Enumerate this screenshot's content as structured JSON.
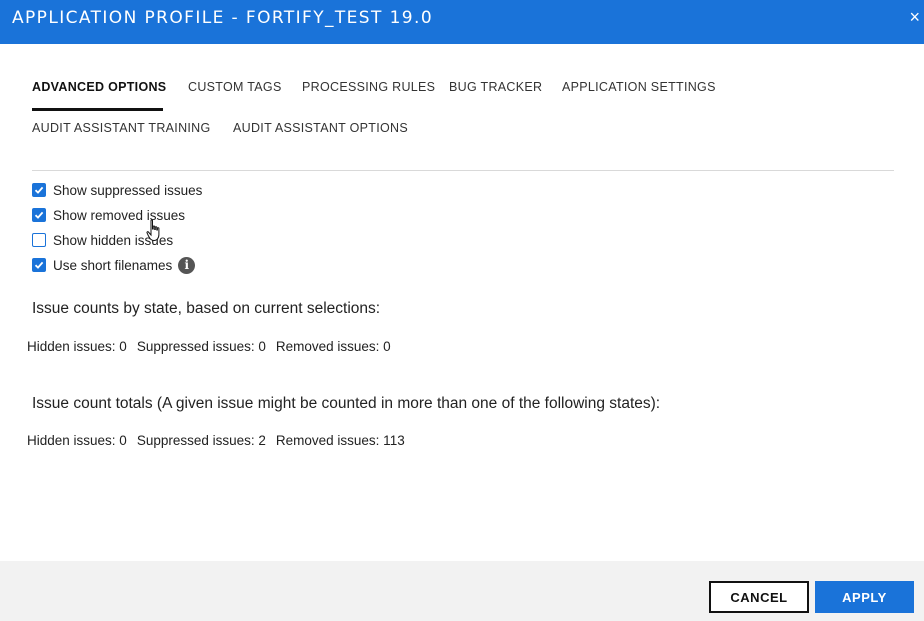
{
  "titlebar": {
    "title": "APPLICATION PROFILE - FORTIFY_TEST 19.0",
    "close_label": "×"
  },
  "tabs": [
    {
      "label": "ADVANCED OPTIONS",
      "active": true
    },
    {
      "label": "CUSTOM TAGS",
      "active": false
    },
    {
      "label": "PROCESSING RULES",
      "active": false
    },
    {
      "label": "BUG TRACKER",
      "active": false
    },
    {
      "label": "APPLICATION SETTINGS",
      "active": false
    },
    {
      "label": "AUDIT ASSISTANT TRAINING",
      "active": false
    },
    {
      "label": "AUDIT ASSISTANT OPTIONS",
      "active": false
    }
  ],
  "options": [
    {
      "label": "Show suppressed issues",
      "checked": true
    },
    {
      "label": "Show removed issues",
      "checked": true
    },
    {
      "label": "Show hidden issues",
      "checked": false
    },
    {
      "label": "Use short filenames",
      "checked": true,
      "info_icon": "info-icon"
    }
  ],
  "current_counts": {
    "heading": "Issue counts by state, based on current selections:",
    "hidden": "Hidden issues: 0",
    "suppressed": "Suppressed issues: 0",
    "removed": "Removed issues: 0"
  },
  "total_counts": {
    "heading": "Issue count totals (A given issue might be counted in more than one of the following states):",
    "hidden": "Hidden issues: 0",
    "suppressed": "Suppressed issues: 2",
    "removed": "Removed issues: 113"
  },
  "footer": {
    "cancel_label": "CANCEL",
    "apply_label": "APPLY"
  },
  "colors": {
    "accent": "#1a73d9",
    "footer_bg": "#f2f2f2"
  }
}
